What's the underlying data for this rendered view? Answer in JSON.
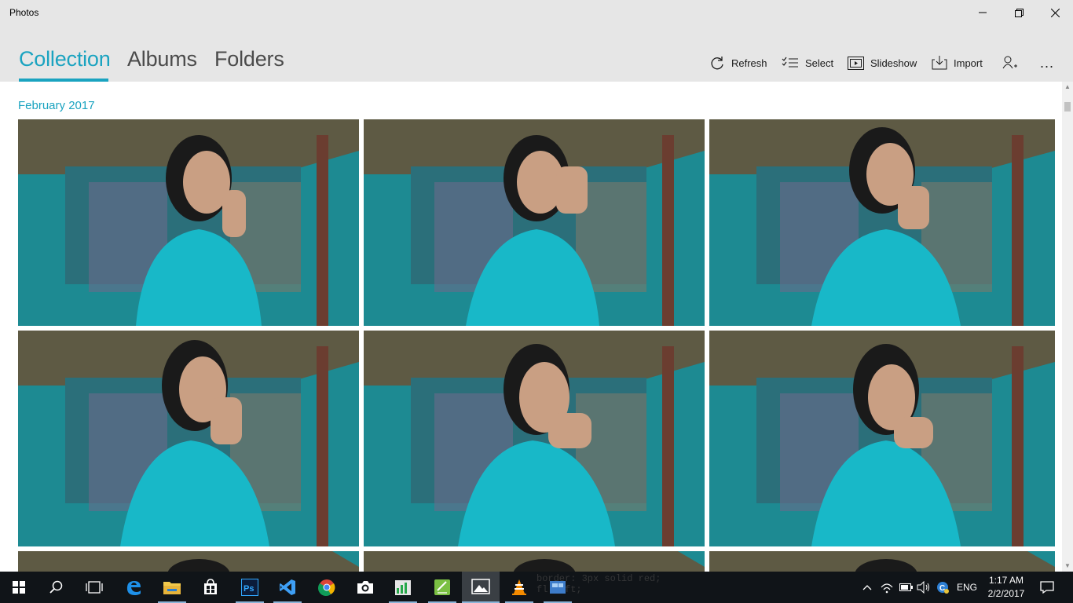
{
  "window": {
    "title": "Photos",
    "minimize_icon": "minimize-icon",
    "restore_icon": "restore-icon",
    "close_icon": "close-icon"
  },
  "tabs": [
    {
      "label": "Collection",
      "active": true
    },
    {
      "label": "Albums",
      "active": false
    },
    {
      "label": "Folders",
      "active": false
    }
  ],
  "commands": {
    "refresh": "Refresh",
    "select": "Select",
    "slideshow": "Slideshow",
    "import": "Import",
    "more": "..."
  },
  "collection": {
    "date_heading": "February 2017",
    "photo_count_visible": 9
  },
  "taskbar": {
    "apps": [
      "start-icon",
      "search-icon",
      "task-view-icon",
      "edge-icon",
      "file-explorer-icon",
      "store-icon",
      "photoshop-icon",
      "visual-studio-icon",
      "chrome-icon",
      "camera-icon",
      "spreadsheet-icon",
      "notepad-icon",
      "photos-icon",
      "vlc-icon",
      "app-icon"
    ],
    "language": "ENG",
    "time": "1:17 AM",
    "date": "2/2/2017",
    "background_code_line1": "border: 3px solid red;",
    "background_code_line2": "fl   left;"
  },
  "colors": {
    "accent": "#1aa3c0",
    "chrome_bg": "#e6e6e6",
    "taskbar_bg": "#101418"
  }
}
